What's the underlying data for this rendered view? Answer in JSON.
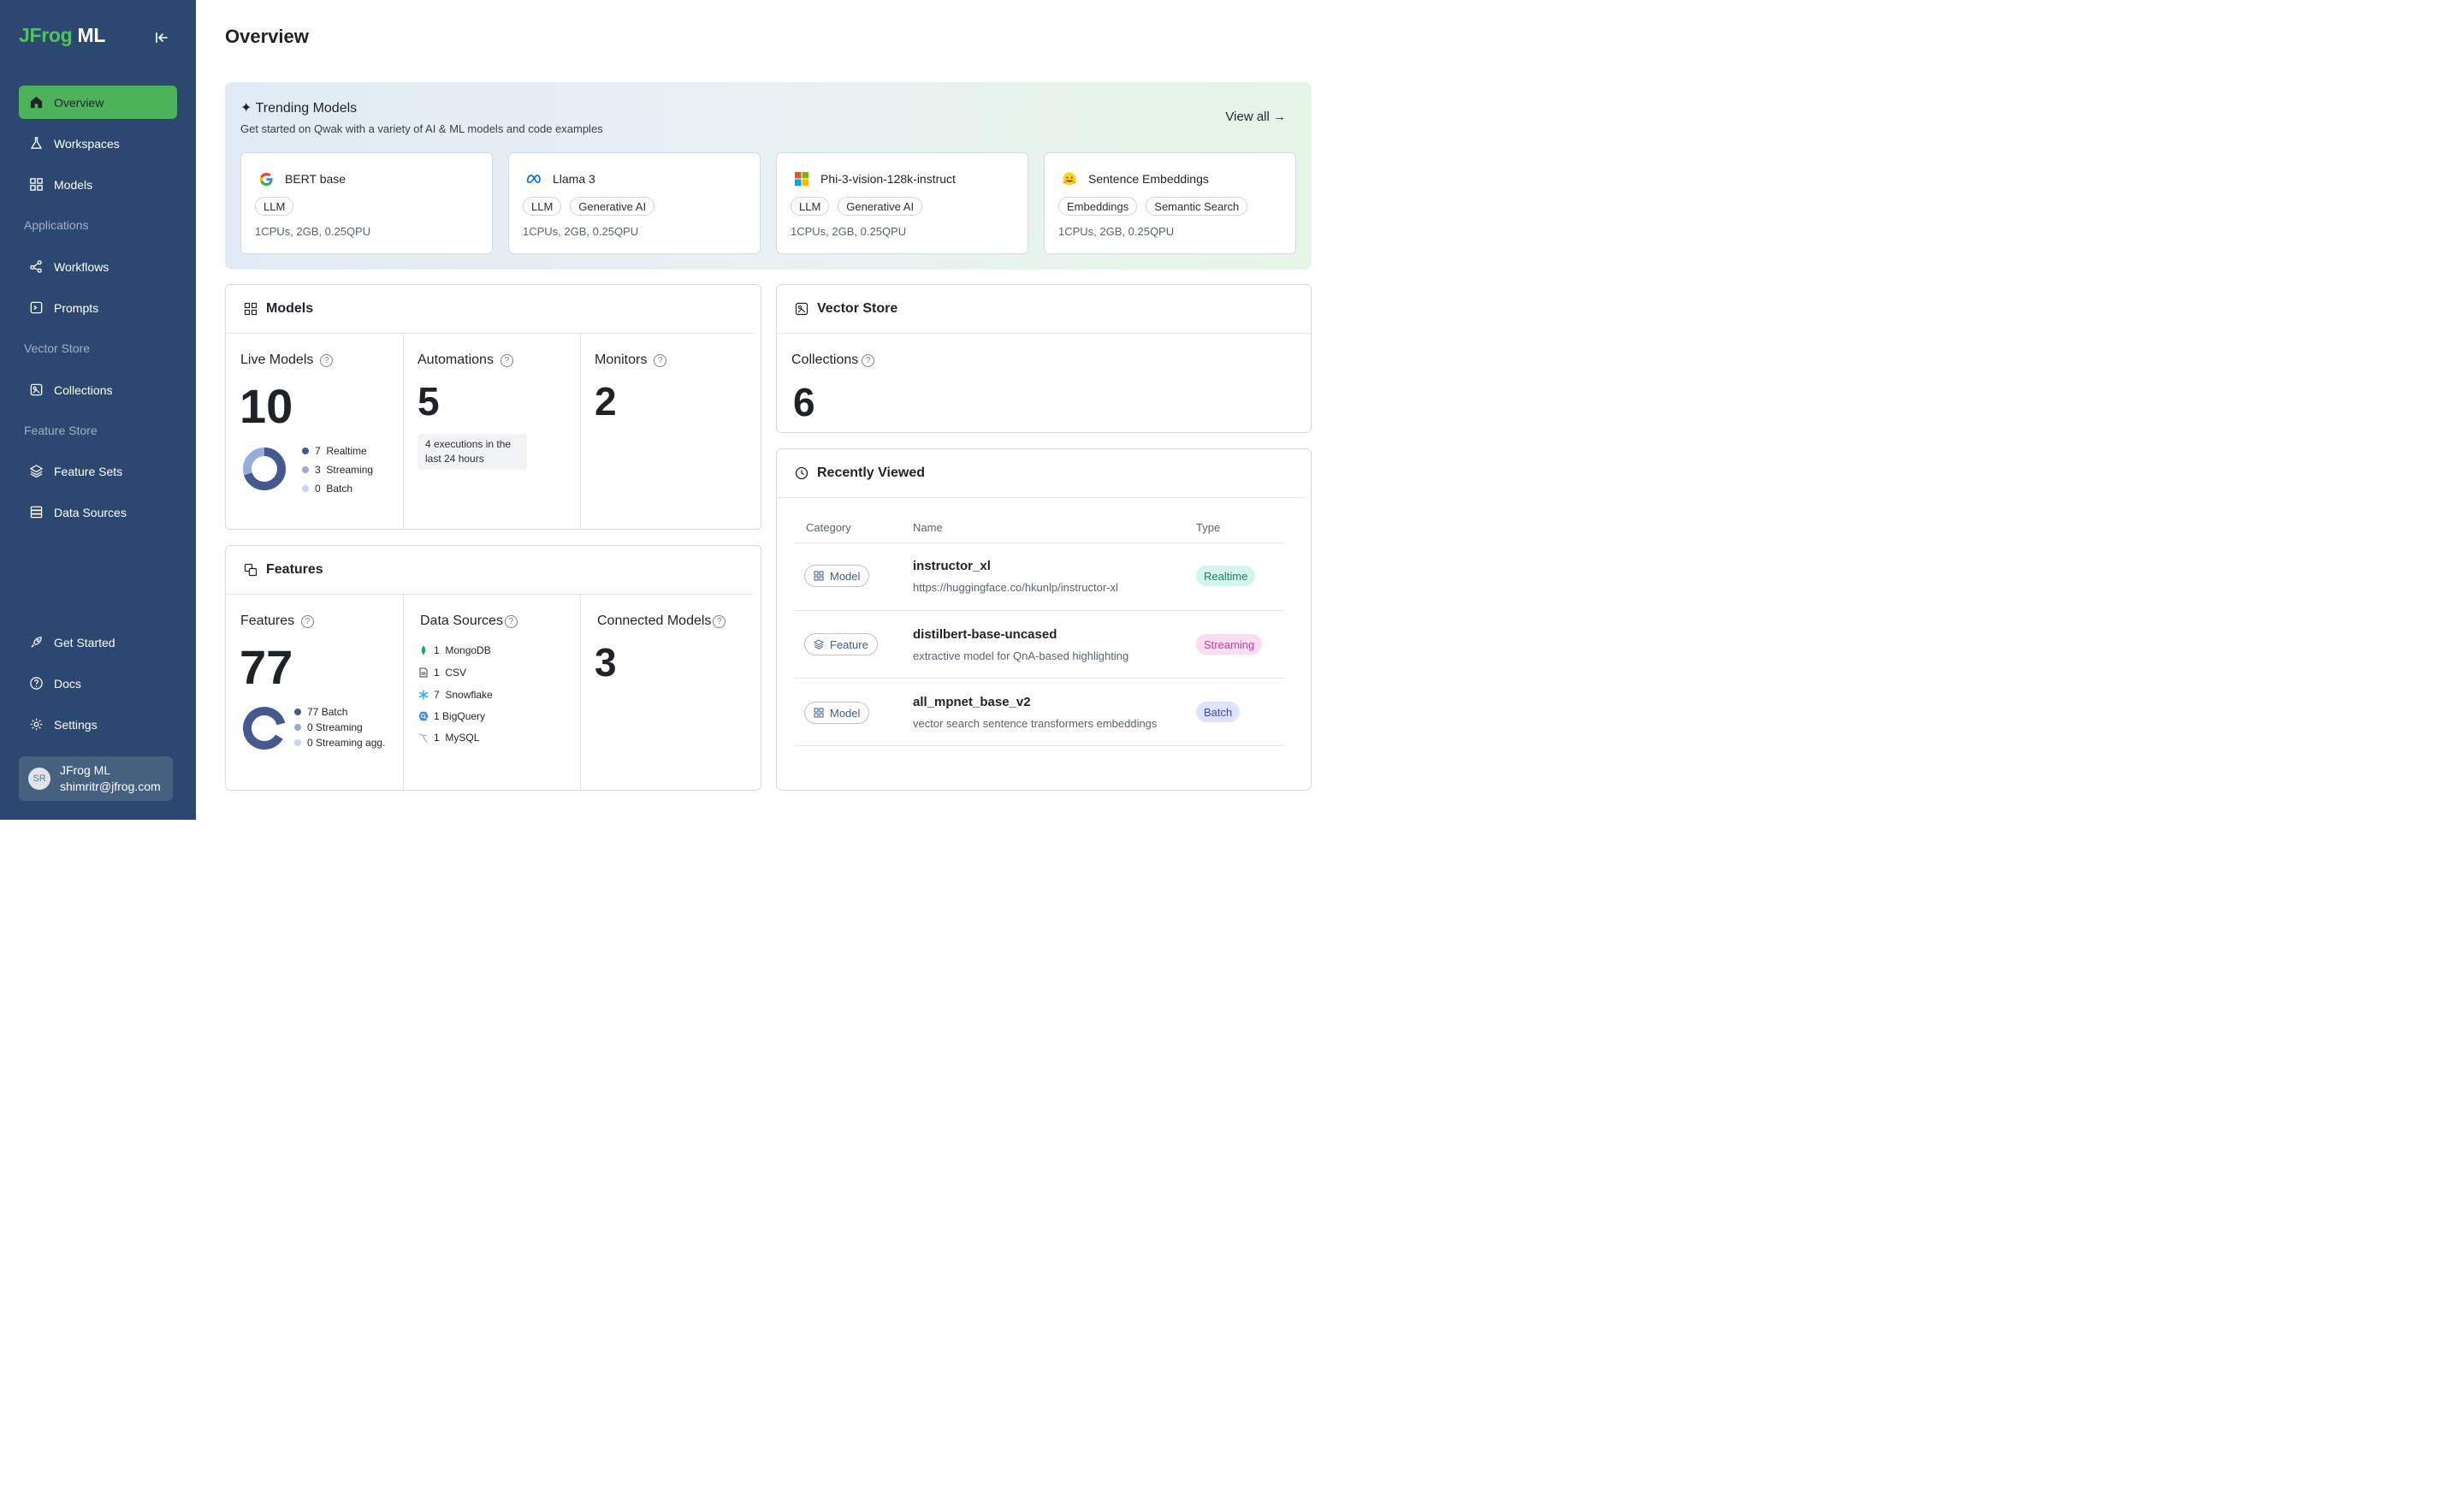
{
  "brand": {
    "jfrog": "JFrog",
    "ml": "ML",
    "colors": {
      "accent": "#4cb35a",
      "sidebar": "#2c4870"
    }
  },
  "sidebar": {
    "items": [
      {
        "label": "Overview",
        "icon": "home-icon",
        "active": true
      },
      {
        "label": "Workspaces",
        "icon": "flask-icon"
      },
      {
        "label": "Models",
        "icon": "grid-icon"
      },
      {
        "label": "Workflows",
        "icon": "workflow-icon"
      },
      {
        "label": "Prompts",
        "icon": "prompt-icon"
      },
      {
        "label": "Collections",
        "icon": "collections-icon"
      },
      {
        "label": "Feature Sets",
        "icon": "layers-icon"
      },
      {
        "label": "Data Sources",
        "icon": "database-icon"
      },
      {
        "label": "Get Started",
        "icon": "rocket-icon"
      },
      {
        "label": "Docs",
        "icon": "help-icon"
      },
      {
        "label": "Settings",
        "icon": "gear-icon"
      }
    ],
    "sections": {
      "applications": "Applications",
      "vector_store": "Vector Store",
      "feature_store": "Feature Store"
    },
    "user": {
      "initials": "SR",
      "name": "JFrog ML",
      "email": "shimritr@jfrog.com"
    }
  },
  "page": {
    "title": "Overview"
  },
  "trending": {
    "title": "✦ Trending Models",
    "subtitle": "Get started on Qwak with a variety of AI & ML models and code examples",
    "view_all": "View all →",
    "cards": [
      {
        "name": "BERT base",
        "logo": "google-logo",
        "tags": [
          "LLM"
        ],
        "spec": "1CPUs, 2GB, 0.25QPU"
      },
      {
        "name": "Llama 3",
        "logo": "meta-logo",
        "tags": [
          "LLM",
          "Generative AI"
        ],
        "spec": "1CPUs, 2GB, 0.25QPU"
      },
      {
        "name": "Phi-3-vision-128k-instruct",
        "logo": "microsoft-logo",
        "tags": [
          "LLM",
          "Generative AI"
        ],
        "spec": "1CPUs, 2GB, 0.25QPU"
      },
      {
        "name": "Sentence Embeddings",
        "logo": "hugging-face-logo",
        "tags": [
          "Embeddings",
          "Semantic Search"
        ],
        "spec": "1CPUs, 2GB, 0.25QPU"
      }
    ]
  },
  "models_panel": {
    "title": "Models",
    "live": {
      "label": "Live Models",
      "value": "10",
      "breakdown": [
        {
          "count": "7",
          "label": "Realtime",
          "color": "#44598f"
        },
        {
          "count": "3",
          "label": "Streaming",
          "color": "#98acd9"
        },
        {
          "count": "0",
          "label": "Batch",
          "color": "#c6d6ee"
        }
      ]
    },
    "automations": {
      "label": "Automations",
      "value": "5",
      "note": "4 executions in the last 24 hours"
    },
    "monitors": {
      "label": "Monitors",
      "value": "2"
    }
  },
  "features_panel": {
    "title": "Features",
    "features": {
      "label": "Features",
      "value": "77",
      "breakdown": [
        {
          "count": "77",
          "label": "Batch",
          "color": "#44598f"
        },
        {
          "count": "0",
          "label": "Streaming",
          "color": "#98acd9"
        },
        {
          "count": "0",
          "label": "Streaming agg.",
          "color": "#c6d6ee"
        }
      ]
    },
    "data_sources": {
      "label": "Data Sources",
      "items": [
        {
          "count": "1",
          "label": "MongoDB",
          "icon": "mongodb-icon"
        },
        {
          "count": "1",
          "label": "CSV",
          "icon": "csv-icon"
        },
        {
          "count": "7",
          "label": "Snowflake",
          "icon": "snowflake-icon"
        },
        {
          "count": "1",
          "label": "BigQuery",
          "icon": "bigquery-icon"
        },
        {
          "count": "1",
          "label": "MySQL",
          "icon": "mysql-icon"
        }
      ]
    },
    "connected": {
      "label": "Connected Models",
      "value": "3"
    }
  },
  "vector_store": {
    "title": "Vector Store",
    "collections": {
      "label": "Collections",
      "value": "6"
    }
  },
  "recently_viewed": {
    "title": "Recently Viewed",
    "columns": [
      "Category",
      "Name",
      "Type"
    ],
    "rows": [
      {
        "category": "Model",
        "name": "instructor_xl",
        "desc": "https://huggingface.co/hkunlp/instructor-xl",
        "type": "Realtime",
        "type_bg": "#d3f5ec",
        "type_fg": "#1d7f63"
      },
      {
        "category": "Feature",
        "name": "distilbert-base-uncased",
        "desc": "extractive model for QnA-based highlighting",
        "type": "Streaming",
        "type_bg": "#fbdcf0",
        "type_fg": "#c43da0"
      },
      {
        "category": "Model",
        "name": "all_mpnet_base_v2",
        "desc": "vector search sentence transformers embeddings",
        "type": "Batch",
        "type_bg": "#dfe3fb",
        "type_fg": "#3d49a8"
      }
    ]
  }
}
